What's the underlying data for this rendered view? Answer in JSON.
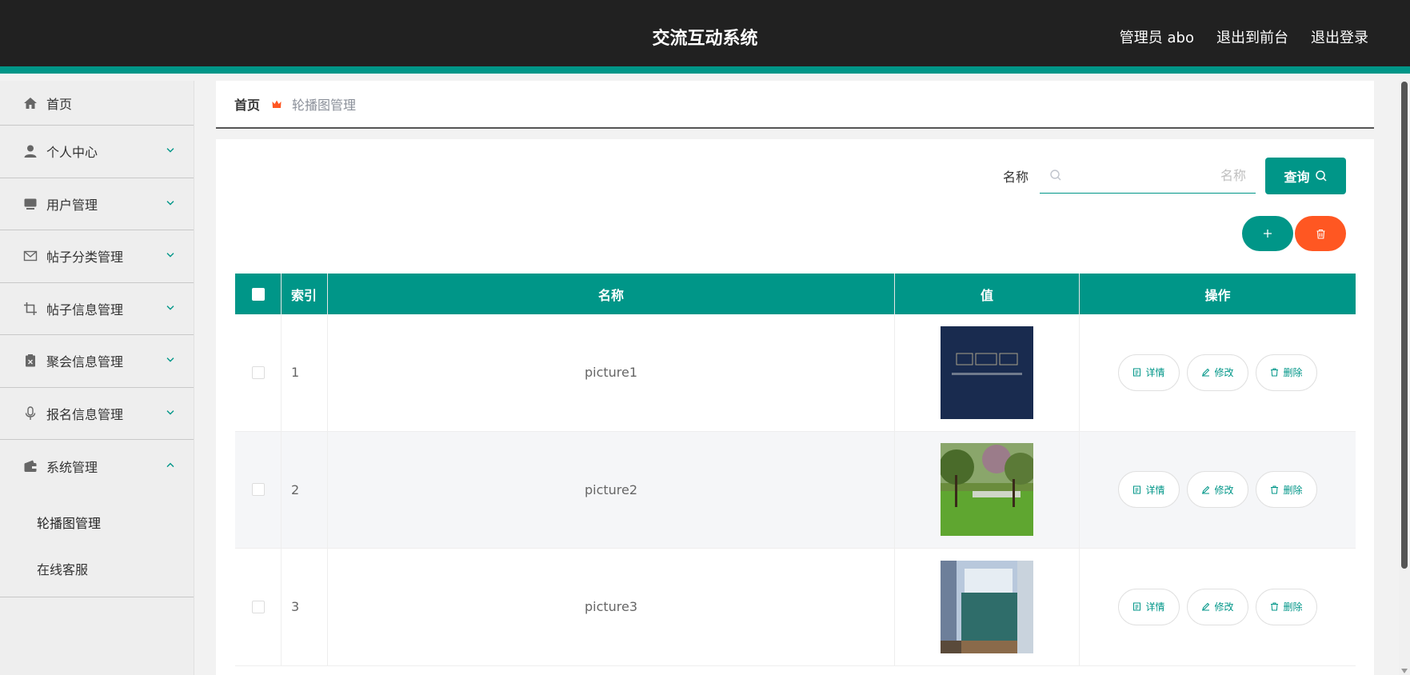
{
  "header": {
    "title": "交流互动系统",
    "admin_label": "管理员 abo",
    "exit_front": "退出到前台",
    "logout": "退出登录"
  },
  "sidebar": {
    "items": [
      {
        "label": "首页",
        "icon": "home-icon"
      },
      {
        "label": "个人中心",
        "icon": "user-icon"
      },
      {
        "label": "用户管理",
        "icon": "monitor-icon"
      },
      {
        "label": "帖子分类管理",
        "icon": "mail-icon"
      },
      {
        "label": "帖子信息管理",
        "icon": "crop-icon"
      },
      {
        "label": "聚会信息管理",
        "icon": "clipboard-icon"
      },
      {
        "label": "报名信息管理",
        "icon": "mic-icon"
      },
      {
        "label": "系统管理",
        "icon": "wallet-icon"
      }
    ],
    "system_sub": [
      "轮播图管理",
      "在线客服"
    ]
  },
  "breadcrumb": {
    "home": "首页",
    "current": "轮播图管理"
  },
  "search": {
    "label": "名称",
    "placeholder": "名称",
    "button": "查询"
  },
  "table": {
    "headers": {
      "index": "索引",
      "name": "名称",
      "value": "值",
      "ops": "操作"
    },
    "rows": [
      {
        "index": "1",
        "name": "picture1",
        "thumb": "dark-blue-banner"
      },
      {
        "index": "2",
        "name": "picture2",
        "thumb": "garden-lawn"
      },
      {
        "index": "3",
        "name": "picture3",
        "thumb": "classroom-window"
      }
    ],
    "ops": {
      "detail": "详情",
      "edit": "修改",
      "delete": "删除"
    }
  },
  "colors": {
    "accent": "#009688",
    "danger": "#ff5722",
    "header_bg": "#212121"
  }
}
